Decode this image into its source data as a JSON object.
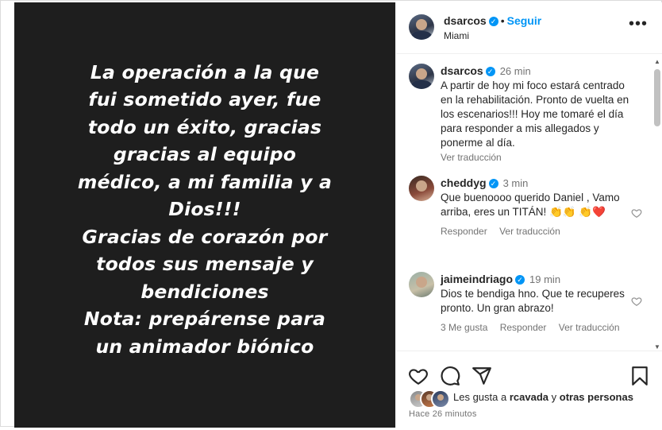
{
  "media": {
    "caption_text": "La operación a la que\nfui sometido ayer, fue\ntodo un éxito, gracias\ngracias al equipo\nmédico, a mi familia y a\nDios!!!\nGracias de corazón por\ntodos sus mensaje y\nbendiciones\nNota: prepárense para\nun animador biónico"
  },
  "header": {
    "username": "dsarcos",
    "follow_label": "Seguir",
    "separator": "•",
    "location": "Miami",
    "more_icon": "more-horizontal-icon"
  },
  "caption": {
    "username": "dsarcos",
    "time": "26 min",
    "text": "A partir de hoy mi foco estará centrado en la rehabilitación. Pronto de vuelta en los escenarios!!! Hoy me tomaré el día para responder a mis allegados y ponerme al día.",
    "translate": "Ver traducción"
  },
  "comments": [
    {
      "username": "cheddyg",
      "time": "3 min",
      "text": "Que buenoooo querido Daniel , Vamo arriba, eres un TITÁN! 👏👏 👏❤️",
      "reply": "Responder",
      "translate": "Ver traducción"
    },
    {
      "username": "jaimeindriago",
      "time": "19 min",
      "text": "Dios te bendiga hno. Que te recuperes pronto. Un gran abrazo!",
      "likes": "3 Me gusta",
      "reply": "Responder",
      "translate": "Ver traducción"
    }
  ],
  "actions": {
    "like_icon": "heart-icon",
    "comment_icon": "comment-icon",
    "share_icon": "send-icon",
    "save_icon": "bookmark-icon",
    "likes_prefix": "Les gusta a",
    "likes_user": "rcavada",
    "likes_connector": "y",
    "likes_others": "otras personas",
    "time_ago": "Hace 26 minutos"
  },
  "colors": {
    "accent": "#0095f6",
    "heart": "#ed4956",
    "media_bg": "#1e1e1e"
  }
}
